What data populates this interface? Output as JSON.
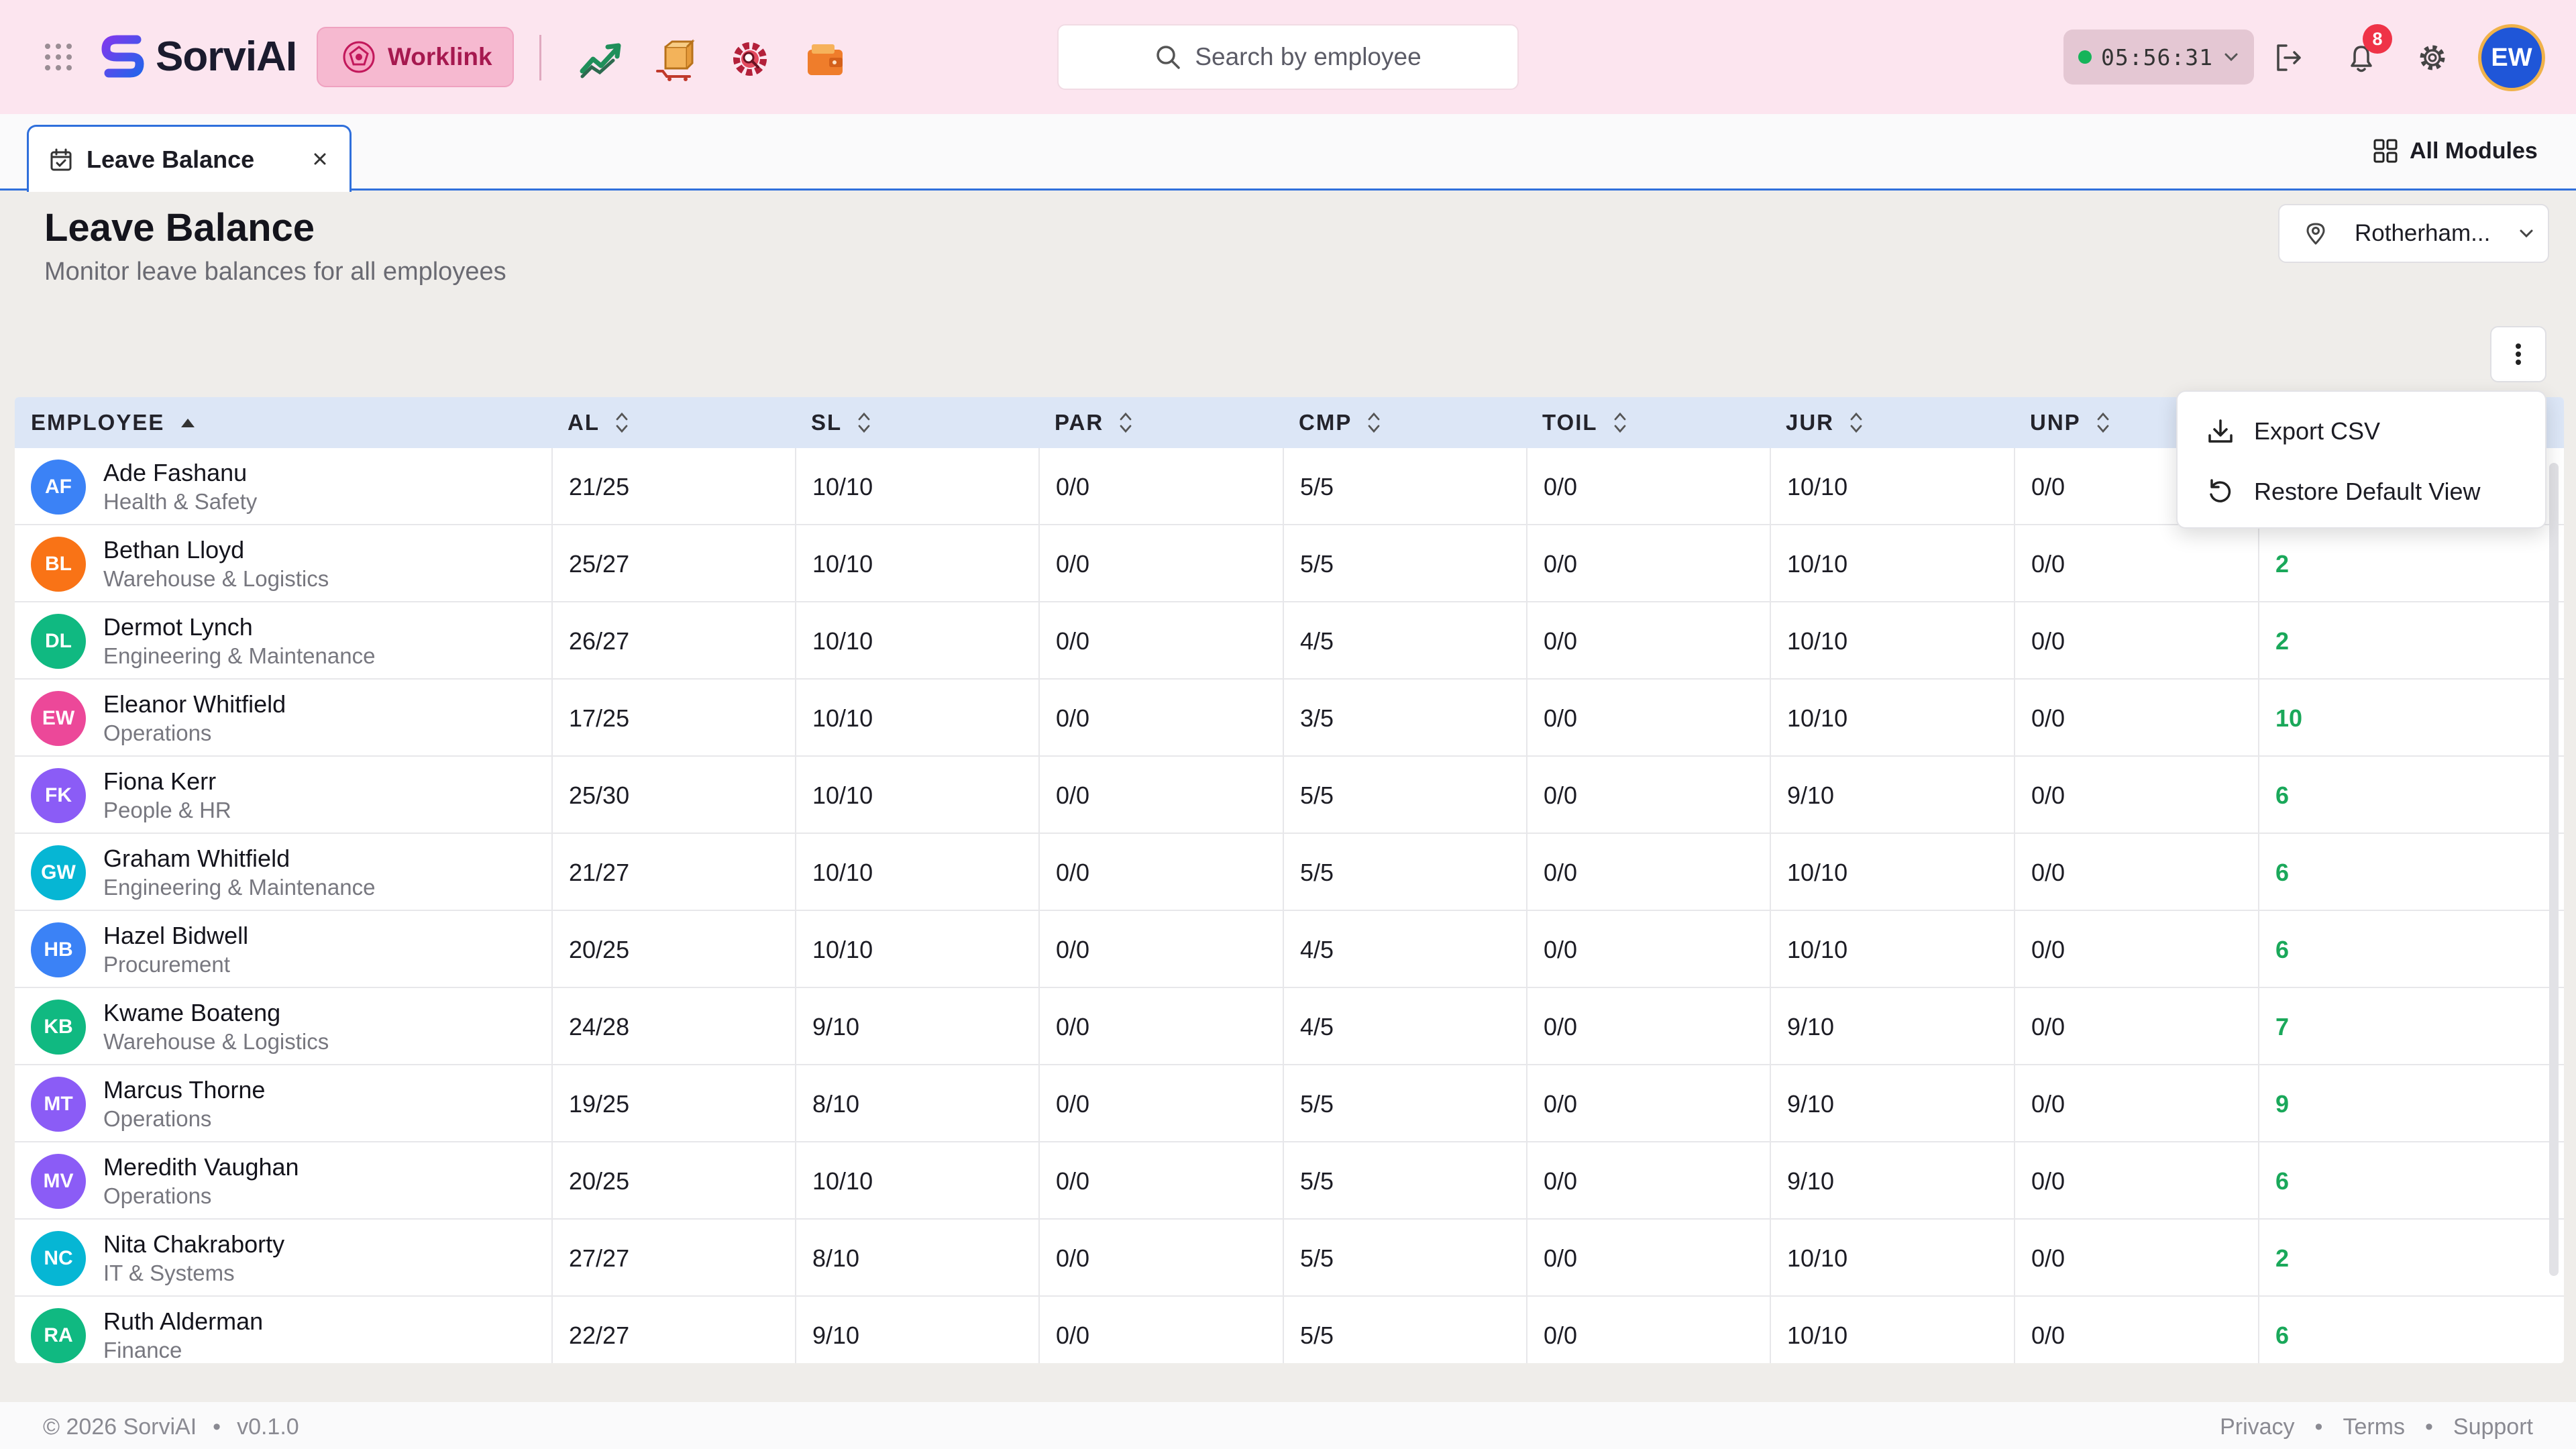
{
  "app": {
    "name": "SorviAI"
  },
  "header": {
    "module_label": "Worklink",
    "search_placeholder": "Search by employee",
    "clock_time": "05:56:31",
    "notification_count": "8",
    "user_initials": "EW"
  },
  "tabs": [
    {
      "label": "Leave Balance",
      "active": true
    }
  ],
  "all_modules_label": "All Modules",
  "page": {
    "title": "Leave Balance",
    "subtitle": "Monitor leave balances for all employees",
    "location": "Rotherham..."
  },
  "table": {
    "columns": [
      "EMPLOYEE",
      "AL",
      "SL",
      "PAR",
      "CMP",
      "TOIL",
      "JUR",
      "UNP"
    ],
    "rows": [
      {
        "initials": "AF",
        "name": "Ade Fashanu",
        "dept": "Health & Safety",
        "al": "21/25",
        "sl": "10/10",
        "par": "0/0",
        "cmp": "5/5",
        "toil": "0/0",
        "jur": "10/10",
        "unp": "0/0",
        "avail": ""
      },
      {
        "initials": "BL",
        "name": "Bethan Lloyd",
        "dept": "Warehouse & Logistics",
        "al": "25/27",
        "sl": "10/10",
        "par": "0/0",
        "cmp": "5/5",
        "toil": "0/0",
        "jur": "10/10",
        "unp": "0/0",
        "avail": "2"
      },
      {
        "initials": "DL",
        "name": "Dermot Lynch",
        "dept": "Engineering & Maintenance",
        "al": "26/27",
        "sl": "10/10",
        "par": "0/0",
        "cmp": "4/5",
        "toil": "0/0",
        "jur": "10/10",
        "unp": "0/0",
        "avail": "2"
      },
      {
        "initials": "EW",
        "name": "Eleanor Whitfield",
        "dept": "Operations",
        "al": "17/25",
        "sl": "10/10",
        "par": "0/0",
        "cmp": "3/5",
        "toil": "0/0",
        "jur": "10/10",
        "unp": "0/0",
        "avail": "10"
      },
      {
        "initials": "FK",
        "name": "Fiona Kerr",
        "dept": "People & HR",
        "al": "25/30",
        "sl": "10/10",
        "par": "0/0",
        "cmp": "5/5",
        "toil": "0/0",
        "jur": "9/10",
        "unp": "0/0",
        "avail": "6"
      },
      {
        "initials": "GW",
        "name": "Graham Whitfield",
        "dept": "Engineering & Maintenance",
        "al": "21/27",
        "sl": "10/10",
        "par": "0/0",
        "cmp": "5/5",
        "toil": "0/0",
        "jur": "10/10",
        "unp": "0/0",
        "avail": "6"
      },
      {
        "initials": "HB",
        "name": "Hazel Bidwell",
        "dept": "Procurement",
        "al": "20/25",
        "sl": "10/10",
        "par": "0/0",
        "cmp": "4/5",
        "toil": "0/0",
        "jur": "10/10",
        "unp": "0/0",
        "avail": "6"
      },
      {
        "initials": "KB",
        "name": "Kwame Boateng",
        "dept": "Warehouse & Logistics",
        "al": "24/28",
        "sl": "9/10",
        "par": "0/0",
        "cmp": "4/5",
        "toil": "0/0",
        "jur": "9/10",
        "unp": "0/0",
        "avail": "7"
      },
      {
        "initials": "MT",
        "name": "Marcus Thorne",
        "dept": "Operations",
        "al": "19/25",
        "sl": "8/10",
        "par": "0/0",
        "cmp": "5/5",
        "toil": "0/0",
        "jur": "9/10",
        "unp": "0/0",
        "avail": "9"
      },
      {
        "initials": "MV",
        "name": "Meredith Vaughan",
        "dept": "Operations",
        "al": "20/25",
        "sl": "10/10",
        "par": "0/0",
        "cmp": "5/5",
        "toil": "0/0",
        "jur": "9/10",
        "unp": "0/0",
        "avail": "6"
      },
      {
        "initials": "NC",
        "name": "Nita Chakraborty",
        "dept": "IT & Systems",
        "al": "27/27",
        "sl": "8/10",
        "par": "0/0",
        "cmp": "5/5",
        "toil": "0/0",
        "jur": "10/10",
        "unp": "0/0",
        "avail": "2"
      },
      {
        "initials": "RA",
        "name": "Ruth Alderman",
        "dept": "Finance",
        "al": "22/27",
        "sl": "9/10",
        "par": "0/0",
        "cmp": "5/5",
        "toil": "0/0",
        "jur": "10/10",
        "unp": "0/0",
        "avail": "6"
      }
    ]
  },
  "avatar_colors": {
    "AF": "#3b82f6",
    "BL": "#f97316",
    "DL": "#10b981",
    "EW": "#ec4899",
    "FK": "#8b5cf6",
    "GW": "#06b6d4",
    "HB": "#3b82f6",
    "KB": "#10b981",
    "MT": "#8b5cf6",
    "MV": "#8b5cf6",
    "NC": "#06b6d4",
    "RA": "#10b981"
  },
  "menu": {
    "items": [
      {
        "label": "Export CSV",
        "icon": "download-icon"
      },
      {
        "label": "Restore Default View",
        "icon": "undo-icon"
      }
    ]
  },
  "footer": {
    "copyright": "© 2026 SorviAI",
    "version": "v0.1.0",
    "links": [
      "Privacy",
      "Terms",
      "Support"
    ]
  }
}
